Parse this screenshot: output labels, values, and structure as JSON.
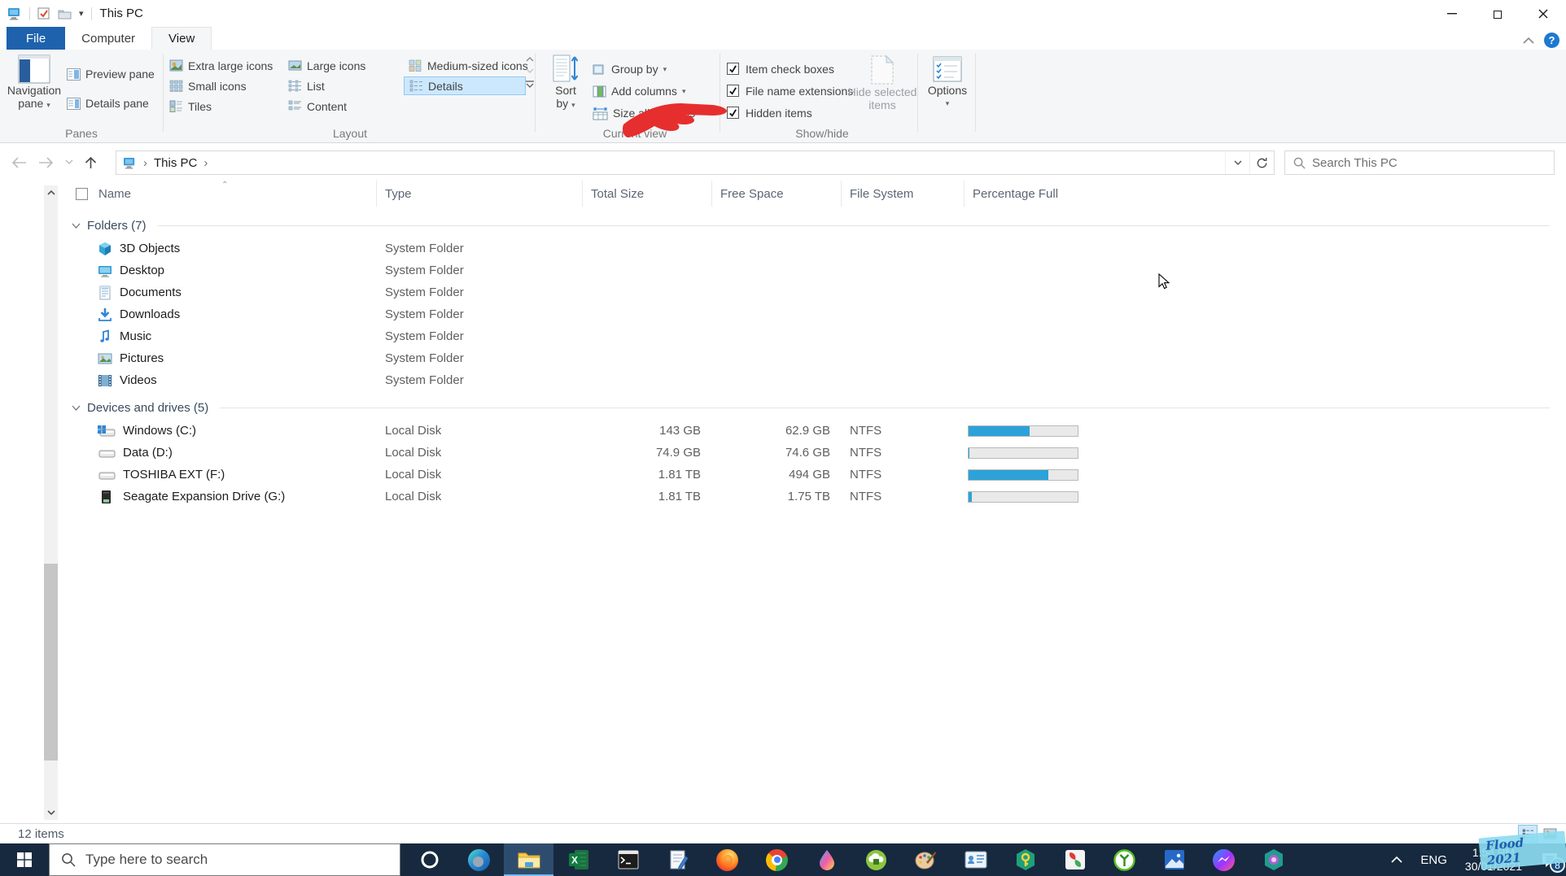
{
  "titlebar": {
    "title": "This PC"
  },
  "tabs": {
    "file": "File",
    "computer": "Computer",
    "view": "View"
  },
  "ribbon": {
    "panes": {
      "label": "Panes",
      "navigation_line1": "Navigation",
      "navigation_line2": "pane",
      "preview": "Preview pane",
      "details": "Details pane"
    },
    "layout": {
      "label": "Layout",
      "extra_large": "Extra large icons",
      "large": "Large icons",
      "medium": "Medium-sized icons",
      "small": "Small icons",
      "list": "List",
      "details": "Details",
      "tiles": "Tiles",
      "content": "Content",
      "selected": "Details"
    },
    "current_view": {
      "label": "Current view",
      "sort_line1": "Sort",
      "sort_line2": "by",
      "group_by": "Group by",
      "add_columns": "Add columns",
      "size_all_columns": "Size all columns"
    },
    "show_hide": {
      "label": "Show/hide",
      "checkboxes": [
        {
          "label": "Item check boxes",
          "checked": true
        },
        {
          "label": "File name extensions",
          "checked": true
        },
        {
          "label": "Hidden items",
          "checked": true
        }
      ],
      "hide_selected_line1": "Hide selected",
      "hide_selected_line2": "items"
    },
    "options": {
      "label": "Options"
    }
  },
  "nav": {
    "breadcrumb": "This PC",
    "search_placeholder": "Search This PC"
  },
  "list": {
    "columns": {
      "name": "Name",
      "type": "Type",
      "total": "Total Size",
      "free": "Free Space",
      "fs": "File System",
      "pct": "Percentage Full"
    },
    "groups": [
      {
        "label": "Folders (7)",
        "rows": [
          {
            "name": "3D Objects",
            "type": "System Folder"
          },
          {
            "name": "Desktop",
            "type": "System Folder"
          },
          {
            "name": "Documents",
            "type": "System Folder"
          },
          {
            "name": "Downloads",
            "type": "System Folder"
          },
          {
            "name": "Music",
            "type": "System Folder"
          },
          {
            "name": "Pictures",
            "type": "System Folder"
          },
          {
            "name": "Videos",
            "type": "System Folder"
          }
        ]
      },
      {
        "label": "Devices and drives (5)",
        "rows": [
          {
            "name": "Windows (C:)",
            "type": "Local Disk",
            "total": "143 GB",
            "free": "62.9 GB",
            "fs": "NTFS",
            "pct": 56
          },
          {
            "name": "Data (D:)",
            "type": "Local Disk",
            "total": "74.9 GB",
            "free": "74.6 GB",
            "fs": "NTFS",
            "pct": 1
          },
          {
            "name": "TOSHIBA EXT (F:)",
            "type": "Local Disk",
            "total": "1.81 TB",
            "free": "494 GB",
            "fs": "NTFS",
            "pct": 73
          },
          {
            "name": "Seagate Expansion Drive (G:)",
            "type": "Local Disk",
            "total": "1.81 TB",
            "free": "1.75 TB",
            "fs": "NTFS",
            "pct": 3
          }
        ]
      }
    ]
  },
  "status": {
    "count": "12 items"
  },
  "taskbar": {
    "search_placeholder": "Type here to search",
    "tray": {
      "lang": "ENG",
      "time": "1:54 PM",
      "date": "30/01/2021",
      "badge": "8"
    }
  },
  "watermark": {
    "text": "Flood 2021"
  },
  "colors": {
    "bar_fill": "#2da2d8",
    "annotation_arrow": "#e62e2e",
    "file_tab": "#1e62ad",
    "taskbar": "#17293e"
  }
}
